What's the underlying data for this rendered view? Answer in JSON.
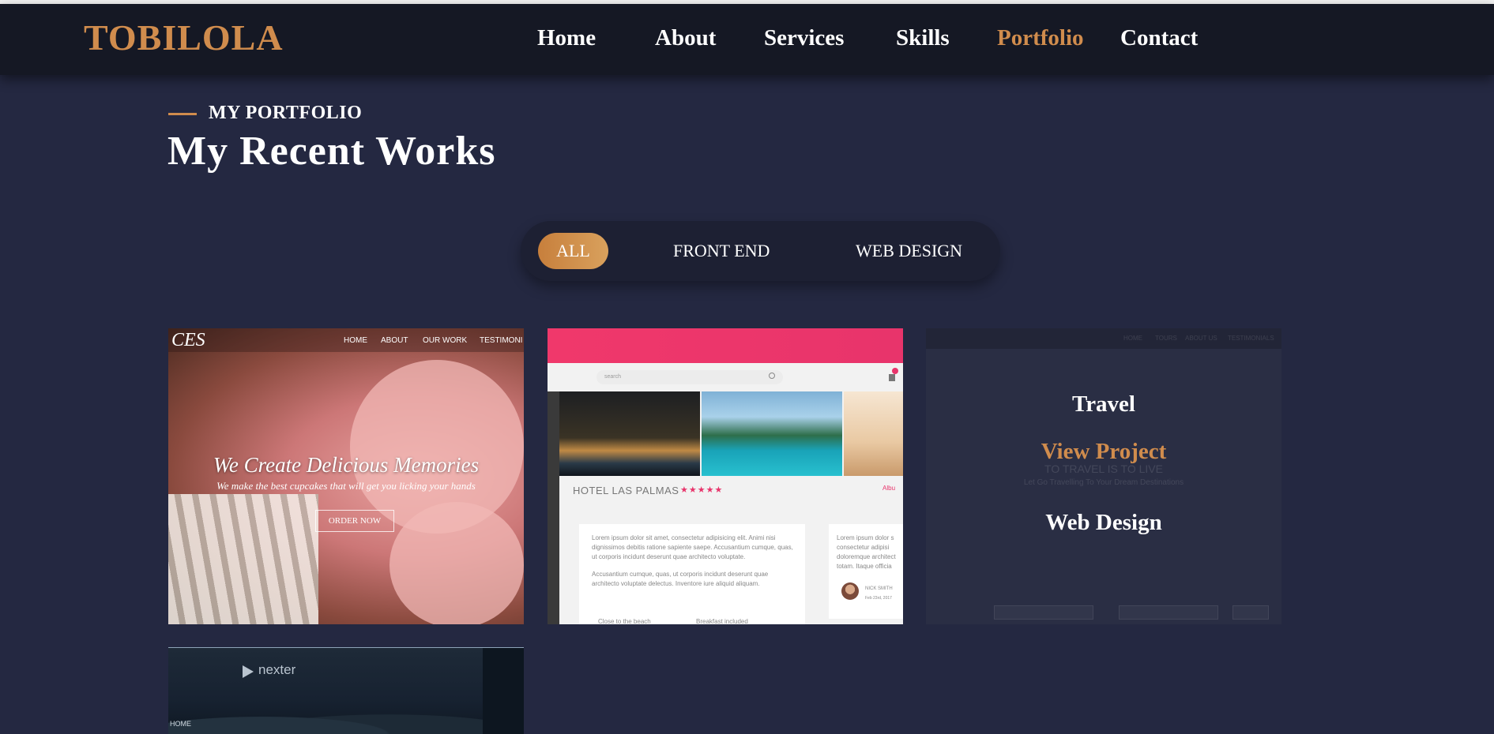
{
  "brand": {
    "name": "TOBILOLA",
    "accent_color": "#d08c4d"
  },
  "nav": {
    "items": [
      {
        "label": "Home",
        "active": false
      },
      {
        "label": "About",
        "active": false
      },
      {
        "label": "Services",
        "active": false
      },
      {
        "label": "Skills",
        "active": false
      },
      {
        "label": "Portfolio",
        "active": true
      },
      {
        "label": "Contact",
        "active": false
      }
    ]
  },
  "section": {
    "eyebrow": "MY PORTFOLIO",
    "title": "My Recent Works"
  },
  "filters": {
    "items": [
      {
        "label": "ALL",
        "active": true
      },
      {
        "label": "FRONT END",
        "active": false
      },
      {
        "label": "WEB DESIGN",
        "active": false
      }
    ]
  },
  "projects": [
    {
      "preview": {
        "brand": "CES",
        "menu": [
          "HOME",
          "ABOUT",
          "OUR WORK",
          "TESTIMONI"
        ],
        "headline": "We Create Delicious Memories",
        "subline": "We make the best cupcakes that will get you licking your hands",
        "button": "ORDER NOW"
      }
    },
    {
      "preview": {
        "search_placeholder": "search",
        "hotel_name": "HOTEL LAS PALMAS",
        "stars": "★★★★★",
        "location": "Albu",
        "text1": "Lorem ipsum dolor sit amet, consectetur adipisicing elit. Animi nisi dignissimos debitis ratione sapiente saepe. Accusantium cumque, quas, ut corporis incidunt deserunt quae architecto voluptate.",
        "text2": "Accusantium cumque, quas, ut corporis incidunt deserunt quae architecto voluptate delectus. Inventore iure aliquid aliquam.",
        "quote": "Lorem ipsum dolor s consectetur adipisi doloremque architect totam. Itaque officia",
        "reviewer": "NICK SMITH",
        "review_date": "Feb 23rd, 2017",
        "bullet1": "Close to the beach",
        "bullet2": "Breakfast included"
      }
    },
    {
      "overlay": {
        "title": "Travel",
        "link": "View Project",
        "category": "Web Design"
      },
      "preview": {
        "menu": [
          "HOME",
          "TOURS",
          "ABOUT US",
          "TESTIMONIALS"
        ],
        "heading": "TO TRAVEL IS TO LIVE",
        "subline": "Let Go Travelling To Your Dream Destinations"
      }
    },
    {
      "preview": {
        "logo": "nexter",
        "menu_label": "HOME"
      }
    }
  ]
}
